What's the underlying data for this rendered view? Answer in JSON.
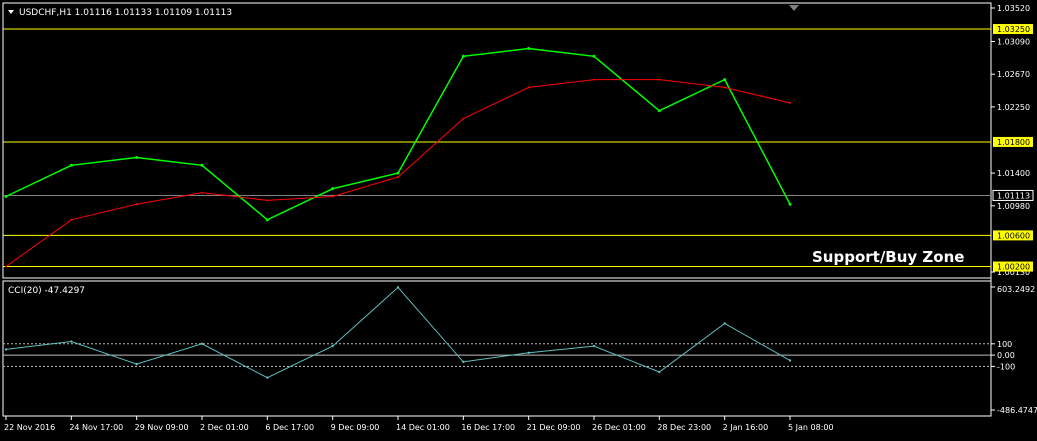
{
  "main_panel": {
    "header": "USDCHF,H1  1.01116 1.01133 1.01109 1.01113",
    "annotation": "Support/Buy Zone",
    "price_ticks": [
      "1.03520",
      "1.03090",
      "1.02670",
      "1.02250",
      "1.01400",
      "1.00980",
      "1.00130"
    ],
    "level_labels": [
      "1.03250",
      "1.01800",
      "1.00600",
      "1.00200"
    ],
    "current_price_label": "1.01113"
  },
  "cci_panel": {
    "header": "CCI(20) -47.4297",
    "ticks": [
      "603.2492",
      "100",
      "0.00",
      "-100",
      "-486.4747"
    ]
  },
  "time_axis": {
    "labels": [
      "22 Nov 2016",
      "24 Nov 17:00",
      "29 Nov 09:00",
      "2 Dec 01:00",
      "6 Dec 17:00",
      "9 Dec 09:00",
      "14 Dec 01:00",
      "16 Dec 17:00",
      "21 Dec 09:00",
      "26 Dec 01:00",
      "28 Dec 23:00",
      "2 Jan 16:00",
      "5 Jan 08:00"
    ]
  },
  "colors": {
    "background": "#000000",
    "price_line": "#00ff00",
    "moving_average": "#ff0000",
    "level_lines": "#ffff00",
    "cci_line": "#5fbfbf",
    "grid_text": "#ffffff"
  },
  "chart_data": [
    {
      "type": "line",
      "symbol": "USDCHF",
      "timeframe": "H1",
      "x": [
        "22 Nov 2016",
        "24 Nov 17:00",
        "29 Nov 09:00",
        "2 Dec 01:00",
        "6 Dec 17:00",
        "9 Dec 09:00",
        "14 Dec 01:00",
        "16 Dec 17:00",
        "21 Dec 09:00",
        "26 Dec 01:00",
        "28 Dec 23:00",
        "2 Jan 16:00",
        "5 Jan 08:00"
      ],
      "series": [
        {
          "values": [
            1.011,
            1.015,
            1.016,
            1.015,
            1.008,
            1.012,
            1.014,
            1.029,
            1.03,
            1.029,
            1.022,
            1.026,
            1.01
          ]
        },
        {
          "values": [
            1.002,
            1.008,
            1.01,
            1.0115,
            1.0105,
            1.011,
            1.0135,
            1.021,
            1.025,
            1.026,
            1.026,
            1.025,
            1.023
          ]
        }
      ],
      "horizontal_levels": [
        1.0325,
        1.018,
        1.006,
        1.002
      ],
      "ylim": [
        1.0013,
        1.0352
      ],
      "grid": false
    },
    {
      "type": "line",
      "indicator": "CCI(20)",
      "x": [
        "22 Nov 2016",
        "24 Nov 17:00",
        "29 Nov 09:00",
        "2 Dec 01:00",
        "6 Dec 17:00",
        "9 Dec 09:00",
        "14 Dec 01:00",
        "16 Dec 17:00",
        "21 Dec 09:00",
        "26 Dec 01:00",
        "28 Dec 23:00",
        "2 Jan 16:00",
        "5 Jan 08:00"
      ],
      "values": [
        50,
        120,
        -80,
        100,
        -200,
        80,
        600,
        -60,
        20,
        80,
        -150,
        280,
        -47.4297
      ],
      "horizontal_levels": [
        100,
        0,
        -100
      ],
      "ylim": [
        -486.4747,
        603.2492
      ],
      "grid": false
    }
  ]
}
